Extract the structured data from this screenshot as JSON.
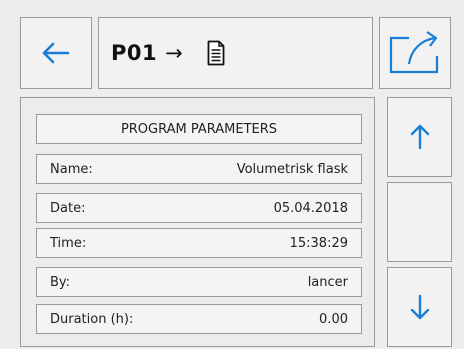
{
  "header": {
    "program_id": "P01",
    "arrow": "→"
  },
  "section_title": "PROGRAM PARAMETERS",
  "fields": [
    {
      "label": "Name:",
      "value": "Volumetrisk flask"
    },
    {
      "label": "Date:",
      "value": "05.04.2018"
    },
    {
      "label": "Time:",
      "value": "15:38:29"
    },
    {
      "label": "By:",
      "value": "lancer"
    },
    {
      "label": "Duration (h):",
      "value": "0.00"
    }
  ],
  "icons": {
    "back": "arrow-left-icon",
    "document": "document-icon",
    "export": "export-icon",
    "scroll_up": "arrow-up-icon",
    "scroll_down": "arrow-down-icon"
  },
  "colors": {
    "accent": "#1a7fd4",
    "background": "#ededed",
    "panel": "#f2f2f2",
    "border": "#9a9a9a"
  }
}
